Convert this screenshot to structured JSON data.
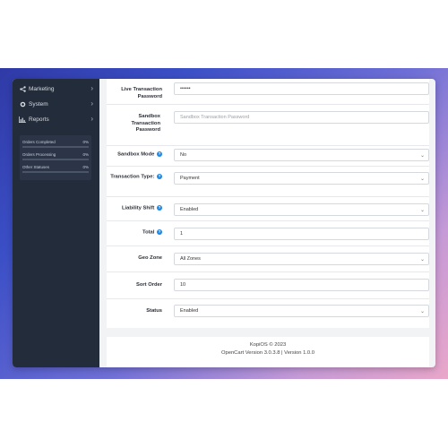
{
  "sidebar": {
    "items": [
      {
        "label": "Marketing",
        "icon": "share-icon"
      },
      {
        "label": "System",
        "icon": "gear-icon"
      },
      {
        "label": "Reports",
        "icon": "bar-chart-icon"
      }
    ],
    "stats": [
      {
        "label": "Orders Completed",
        "value": "0%"
      },
      {
        "label": "Orders Processing",
        "value": "0%"
      },
      {
        "label": "Other Statuses",
        "value": "0%"
      }
    ]
  },
  "form": {
    "live_password": {
      "label": "Live Transaction Password",
      "value": "••••••"
    },
    "sandbox_password": {
      "label": "Sandbox Transaction Password",
      "placeholder": "Sandbox Transaction Password"
    },
    "sandbox_mode": {
      "label": "Sandbox Mode",
      "value": "No"
    },
    "transaction_type": {
      "label": "Transaction Type:",
      "value": "Payment"
    },
    "liability_shift": {
      "label": "Liability Shift",
      "value": "Enabled"
    },
    "total": {
      "label": "Total",
      "value": "1"
    },
    "geo_zone": {
      "label": "Geo Zone",
      "value": "All Zones"
    },
    "sort_order": {
      "label": "Sort Order",
      "value": "10"
    },
    "status": {
      "label": "Status",
      "value": "Enabled"
    },
    "help_icon": "?"
  },
  "footer": {
    "line1": "KopiOS © 2023",
    "line2": "OpenCart Version 3.0.3.8 | Version 1.0.0"
  },
  "colors": {
    "sidebar_bg": "#232c3b",
    "accent": "#1e88e5"
  }
}
